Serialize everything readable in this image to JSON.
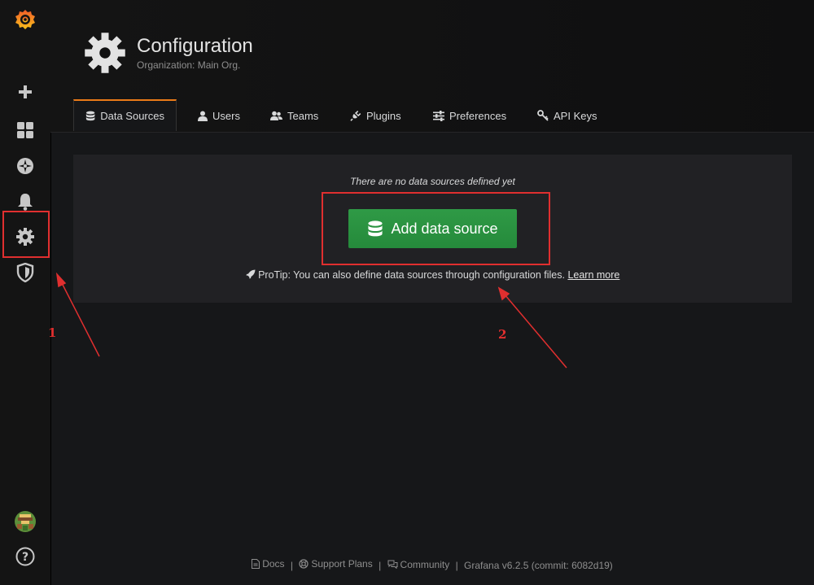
{
  "sidebar": {
    "items": [
      {
        "name": "grafana-logo-icon"
      },
      {
        "name": "plus-icon"
      },
      {
        "name": "dashboards-icon"
      },
      {
        "name": "explore-icon"
      },
      {
        "name": "alerting-icon"
      },
      {
        "name": "gear-icon"
      },
      {
        "name": "shield-icon"
      },
      {
        "name": "avatar"
      },
      {
        "name": "help-icon"
      }
    ]
  },
  "header": {
    "title": "Configuration",
    "subtitle": "Organization: Main Org."
  },
  "tabs": [
    {
      "label": "Data Sources",
      "icon": "database-icon",
      "active": true
    },
    {
      "label": "Users",
      "icon": "user-icon"
    },
    {
      "label": "Teams",
      "icon": "users-icon"
    },
    {
      "label": "Plugins",
      "icon": "plug-icon"
    },
    {
      "label": "Preferences",
      "icon": "sliders-icon"
    },
    {
      "label": "API Keys",
      "icon": "key-icon"
    }
  ],
  "panel": {
    "empty_text": "There are no data sources defined yet",
    "add_button_label": "Add data source",
    "protip_text": "ProTip: You can also define data sources through configuration files.",
    "protip_link": "Learn more"
  },
  "annotations": {
    "label_1": "1",
    "label_2": "2"
  },
  "footer": {
    "docs": "Docs",
    "support": "Support Plans",
    "community": "Community",
    "version": "Grafana v6.2.5 (commit: 6082d19)",
    "separator": "|"
  },
  "colors": {
    "accent": "#eb7b18",
    "button": "#299c46",
    "annotation": "#e02f2f"
  }
}
